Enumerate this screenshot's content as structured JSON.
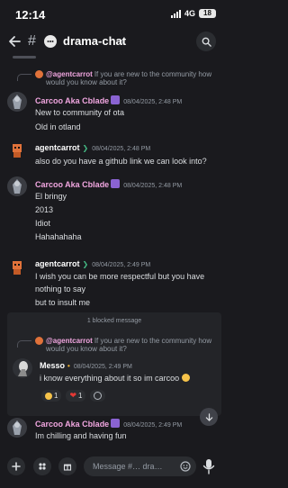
{
  "status_bar": {
    "time": "12:14",
    "network": "4G",
    "battery": "18"
  },
  "header": {
    "channel_name": "drama-chat",
    "chevron": "›",
    "hash": "#"
  },
  "messages": [
    {
      "reply": {
        "author": "@agentcarrot",
        "text": "If you are new to the community how would you know about it?"
      },
      "author": "Carcoo Aka Cblade",
      "timestamp": "08/04/2025, 2:48 PM",
      "lines": [
        "New to community of ota",
        "Old in otland"
      ]
    },
    {
      "author": "agentcarrot",
      "timestamp": "08/04/2025, 2:48 PM",
      "lines": [
        "also do you have a github link we can look into?"
      ]
    },
    {
      "author": "Carcoo Aka Cblade",
      "timestamp": "08/04/2025, 2:48 PM",
      "lines": [
        "El bringy",
        "2013",
        "Idiot",
        "Hahahahaha"
      ]
    },
    {
      "author": "agentcarrot",
      "timestamp": "08/04/2025, 2:49 PM",
      "lines": [
        "I wish you can be more respectful but you have",
        "nothing to say",
        "but to insult me"
      ]
    },
    {
      "blocked_label": "1 blocked message",
      "reply": {
        "author": "@agentcarrot",
        "text": "If you are new to the community how would you know about it?"
      },
      "author": "Messo",
      "timestamp": "08/04/2025, 2:49 PM",
      "lines": [
        "i know everything about it so im carcoo"
      ],
      "reactions": [
        {
          "emoji": "grinning-face",
          "count": "1"
        },
        {
          "emoji": "red-heart",
          "count": "1"
        }
      ]
    },
    {
      "author": "Carcoo Aka Cblade",
      "timestamp": "08/04/2025, 2:49 PM",
      "lines": [
        "Im chilling and having fun"
      ]
    }
  ],
  "composer": {
    "placeholder": "Message #… dra…"
  },
  "colors": {
    "background": "#1a1a1e",
    "carcoo_name": "#f1a6e0",
    "role_leaf": "#43b581",
    "reply_author": "#f1a6e0"
  }
}
